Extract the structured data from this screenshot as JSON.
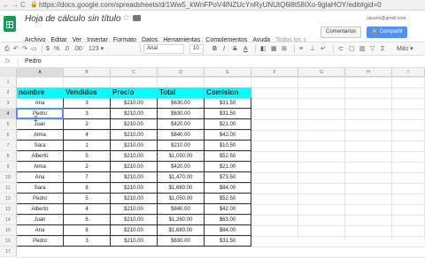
{
  "browser": {
    "nav_back": "←",
    "nav_forward": "→",
    "nav_reload": "C",
    "lock": "🔒",
    "url": "https://docs.google.com/spreadsheets/d/1Ww5_kWnFPoV4lNZUcYnRyUNUtQ6l8t58IXo-9glaHOY/edit#gid=0"
  },
  "header": {
    "title": "Hoja de cálculo sin título",
    "star_icon": "☆",
    "account": "usuario@gmail.com",
    "comments_label": "Comentarios",
    "share_label": "Compartir"
  },
  "menus": [
    "Archivo",
    "Editar",
    "Ver",
    "Insertar",
    "Formato",
    "Datos",
    "Herramientas",
    "Complementos",
    "Ayuda",
    "Todos los c"
  ],
  "toolbar": {
    "print": "⎙",
    "undo": "↶",
    "redo": "↷",
    "paint": "▭",
    "currency": "$",
    "percent": "%",
    "dec0": ".0",
    ".00": ".00",
    "format": "123 ▾",
    "font": "Arial",
    "size": "10",
    "bold": "B",
    "italic": "I",
    "strike": "S",
    "color": "A",
    "more": "Más ▾"
  },
  "formula_bar": {
    "fx": "fx",
    "value": "Pedro"
  },
  "columns": [
    "A",
    "B",
    "C",
    "D",
    "E",
    "F",
    "G",
    "H",
    "I"
  ],
  "rows": [
    "1",
    "2",
    "3",
    "4",
    "5",
    "6",
    "7",
    "8",
    "9",
    "10",
    "11",
    "12",
    "13",
    "14",
    "15",
    "16",
    "17"
  ],
  "table": {
    "headers": [
      "nombre",
      "Vendidos",
      "Precio",
      "Total",
      "Comision"
    ],
    "data": [
      [
        "Ana",
        "3",
        "$210.00",
        "$630.00",
        "$31.50"
      ],
      [
        "Pedro",
        "3",
        "$210.00",
        "$630.00",
        "$31.50"
      ],
      [
        "Juan",
        "2",
        "$210.00",
        "$420.00",
        "$21.00"
      ],
      [
        "Alma",
        "4",
        "$210.00",
        "$840.00",
        "$42.00"
      ],
      [
        "Sara",
        "1",
        "$210.00",
        "$210.00",
        "$10.50"
      ],
      [
        "Alberto",
        "5",
        "$210.00",
        "$1,050.00",
        "$52.50"
      ],
      [
        "Alma",
        "2",
        "$210.00",
        "$420.00",
        "$21.00"
      ],
      [
        "Ana",
        "7",
        "$210.00",
        "$1,470.00",
        "$73.50"
      ],
      [
        "Sara",
        "8",
        "$210.00",
        "$1,680.00",
        "$84.00"
      ],
      [
        "Pedro",
        "5",
        "$210.00",
        "$1,050.00",
        "$52.50"
      ],
      [
        "Alberto",
        "4",
        "$210.00",
        "$840.00",
        "$42.00"
      ],
      [
        "Juan",
        "6",
        "$210.00",
        "$1,260.00",
        "$63.00"
      ],
      [
        "Ana",
        "8",
        "$210.00",
        "$1,680.00",
        "$84.00"
      ],
      [
        "Pedro",
        "3",
        "$210.00",
        "$630.00",
        "$31.50"
      ]
    ]
  },
  "colors": {
    "header_fill": "#00ffff",
    "share_button": "#4d90fe",
    "logo": "#0f9d58",
    "selection": "#4d90fe"
  }
}
